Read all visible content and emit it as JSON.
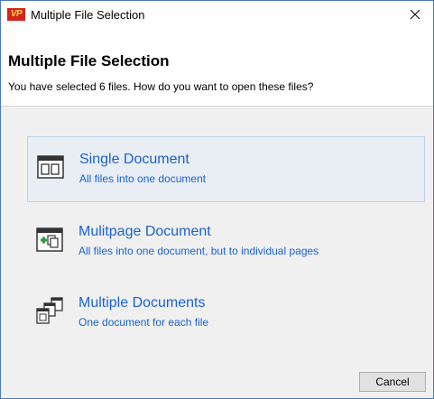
{
  "window": {
    "title": "Multiple File Selection",
    "logo_text": "VP",
    "logo_color": "#d0251c"
  },
  "header": {
    "title": "Multiple File Selection",
    "subtitle": "You have selected 6 files. How do you want to open these files?"
  },
  "options": [
    {
      "icon": "single-document-icon",
      "title": "Single Document",
      "description": "All files into one document",
      "selected": true
    },
    {
      "icon": "multipage-document-icon",
      "title": "Mulitpage Document",
      "description": "All files into one document, but to individual pages",
      "selected": false
    },
    {
      "icon": "multiple-documents-icon",
      "title": "Multiple Documents",
      "description": "One document for each file",
      "selected": false
    }
  ],
  "buttons": {
    "cancel_label": "Cancel"
  },
  "colors": {
    "link_blue": "#1a62cc",
    "selected_bg": "#e9eef4",
    "selected_border": "#b9d1ea",
    "content_bg": "#f0f0f0"
  }
}
